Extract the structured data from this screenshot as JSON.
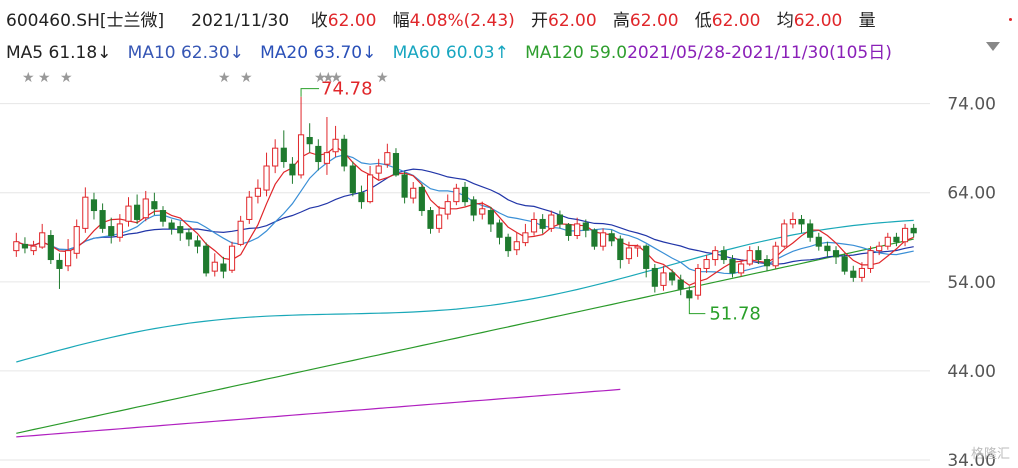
{
  "header": {
    "code": "600460.SH[士兰微]",
    "date": "2021/11/30",
    "close_label": "收",
    "close": "62.00",
    "change_label": "幅",
    "change": "4.08%(2.43)",
    "open_label": "开",
    "open": "62.00",
    "high_label": "高",
    "high": "62.00",
    "low_label": "低",
    "low": "62.00",
    "avg_label": "均",
    "avg": "62.00",
    "vol_label": "量"
  },
  "ma_bar": {
    "ma5": "MA5  61.18↓",
    "ma10": "MA10  62.30↓",
    "ma20": "MA20  63.70↓",
    "ma60": "MA60  60.03↑",
    "ma120": "MA120  59.0",
    "overlap": "2021/05/28-2021/11/30(105日)"
  },
  "colors": {
    "up": "#e0262a",
    "down": "#1f7a2e",
    "ma5": "#e0262a",
    "ma10": "#2236a8",
    "ma20": "#3a8fd6",
    "ma60": "#1aa8b8",
    "ma120": "#2a9a2a",
    "ma250": "#b020c0"
  },
  "watermark": "格隆汇",
  "chart_data": {
    "type": "candlestick",
    "ylim": [
      34,
      78
    ],
    "yticks": [
      "74.00",
      "64.00",
      "54.00",
      "44.00",
      "34.00"
    ],
    "high_mark": "74.78",
    "low_mark": "51.78",
    "candles": [
      [
        57.5,
        58.5,
        56.8,
        59.5
      ],
      [
        58.2,
        57.8,
        57.2,
        59.0
      ],
      [
        57.5,
        58.0,
        57.0,
        58.6
      ],
      [
        57.9,
        59.5,
        57.7,
        60.5
      ],
      [
        59.2,
        56.5,
        56.0,
        59.8
      ],
      [
        56.4,
        55.5,
        53.2,
        57.2
      ],
      [
        55.8,
        57.5,
        55.2,
        58.8
      ],
      [
        57.2,
        60.2,
        56.6,
        61.0
      ],
      [
        60.0,
        63.5,
        59.5,
        64.6
      ],
      [
        63.2,
        62.0,
        61.0,
        64.0
      ],
      [
        62.0,
        60.0,
        59.5,
        62.8
      ],
      [
        60.2,
        59.2,
        58.3,
        61.2
      ],
      [
        59.0,
        60.5,
        58.5,
        61.6
      ],
      [
        60.8,
        62.5,
        60.2,
        63.5
      ],
      [
        62.6,
        61.0,
        60.5,
        63.8
      ],
      [
        61.2,
        63.3,
        60.8,
        64.2
      ],
      [
        63.0,
        62.2,
        61.5,
        64.0
      ],
      [
        62.0,
        60.8,
        60.2,
        62.5
      ],
      [
        60.6,
        60.0,
        59.3,
        61.0
      ],
      [
        60.2,
        59.5,
        58.6,
        60.8
      ],
      [
        59.5,
        58.8,
        58.0,
        60.0
      ],
      [
        58.6,
        58.0,
        57.2,
        59.2
      ],
      [
        58.0,
        55.0,
        54.6,
        58.4
      ],
      [
        55.2,
        56.2,
        54.6,
        57.2
      ],
      [
        56.0,
        55.2,
        54.4,
        56.8
      ],
      [
        55.3,
        58.0,
        55.0,
        58.5
      ],
      [
        58.2,
        60.8,
        58.0,
        61.4
      ],
      [
        61.0,
        63.5,
        60.5,
        64.2
      ],
      [
        63.6,
        64.5,
        62.8,
        65.5
      ],
      [
        64.3,
        67.0,
        63.6,
        68.5
      ],
      [
        67.0,
        69.0,
        66.2,
        70.0
      ],
      [
        69.0,
        67.5,
        66.8,
        71.0
      ],
      [
        67.2,
        66.0,
        65.0,
        68.0
      ],
      [
        66.0,
        70.5,
        65.6,
        74.78
      ],
      [
        70.2,
        69.5,
        68.5,
        71.8
      ],
      [
        69.2,
        67.5,
        66.5,
        70.0
      ],
      [
        67.3,
        68.5,
        66.0,
        72.5
      ],
      [
        68.6,
        70.0,
        68.0,
        71.5
      ],
      [
        70.0,
        67.0,
        66.4,
        70.5
      ],
      [
        67.0,
        64.0,
        63.6,
        67.5
      ],
      [
        64.0,
        63.0,
        62.2,
        64.8
      ],
      [
        63.0,
        66.0,
        62.8,
        67.0
      ],
      [
        66.2,
        67.0,
        65.5,
        67.8
      ],
      [
        67.2,
        68.5,
        66.8,
        69.5
      ],
      [
        68.4,
        66.0,
        65.8,
        69.0
      ],
      [
        66.0,
        63.5,
        62.8,
        66.4
      ],
      [
        63.4,
        64.5,
        62.8,
        65.2
      ],
      [
        64.6,
        62.0,
        61.4,
        65.0
      ],
      [
        62.0,
        60.0,
        59.4,
        62.4
      ],
      [
        60.0,
        61.5,
        59.5,
        62.5
      ],
      [
        61.6,
        63.0,
        61.0,
        63.8
      ],
      [
        63.0,
        64.5,
        62.6,
        65.0
      ],
      [
        64.6,
        63.0,
        62.5,
        65.2
      ],
      [
        63.2,
        61.5,
        60.8,
        63.6
      ],
      [
        61.6,
        62.2,
        61.0,
        63.0
      ],
      [
        62.0,
        60.5,
        59.6,
        62.4
      ],
      [
        60.6,
        59.0,
        58.2,
        61.0
      ],
      [
        59.0,
        57.5,
        56.8,
        59.4
      ],
      [
        57.6,
        58.5,
        57.0,
        59.5
      ],
      [
        58.4,
        59.5,
        58.0,
        60.5
      ],
      [
        59.6,
        61.0,
        59.2,
        61.8
      ],
      [
        61.0,
        60.0,
        59.4,
        61.6
      ],
      [
        60.0,
        61.5,
        59.6,
        62.0
      ],
      [
        61.5,
        60.5,
        60.0,
        62.0
      ],
      [
        60.4,
        59.2,
        58.6,
        60.6
      ],
      [
        59.2,
        60.5,
        58.8,
        61.2
      ],
      [
        60.6,
        59.8,
        59.0,
        61.0
      ],
      [
        59.8,
        58.0,
        57.6,
        60.0
      ],
      [
        58.0,
        59.5,
        57.5,
        60.0
      ],
      [
        59.4,
        58.6,
        58.0,
        59.8
      ],
      [
        58.8,
        56.5,
        55.5,
        59.2
      ],
      [
        56.6,
        57.8,
        56.0,
        58.5
      ],
      [
        57.8,
        58.0,
        56.8,
        58.2
      ],
      [
        58.0,
        55.5,
        54.5,
        58.2
      ],
      [
        55.5,
        53.5,
        52.8,
        56.0
      ],
      [
        53.6,
        55.0,
        53.0,
        55.8
      ],
      [
        55.0,
        54.2,
        53.6,
        55.4
      ],
      [
        54.2,
        53.2,
        52.5,
        54.8
      ],
      [
        53.0,
        52.2,
        51.78,
        53.5
      ],
      [
        52.5,
        55.5,
        52.0,
        56.0
      ],
      [
        55.5,
        56.5,
        55.0,
        57.0
      ],
      [
        56.5,
        57.5,
        55.8,
        58.0
      ],
      [
        57.5,
        56.5,
        56.0,
        58.0
      ],
      [
        56.5,
        55.0,
        54.5,
        57.0
      ],
      [
        55.0,
        56.0,
        54.6,
        56.5
      ],
      [
        56.0,
        57.5,
        55.8,
        58.0
      ],
      [
        57.5,
        56.5,
        56.0,
        58.0
      ],
      [
        56.5,
        55.8,
        55.2,
        57.0
      ],
      [
        55.8,
        58.0,
        55.5,
        58.5
      ],
      [
        58.0,
        60.5,
        57.8,
        61.0
      ],
      [
        60.5,
        61.0,
        60.0,
        61.8
      ],
      [
        61.0,
        60.5,
        59.5,
        61.5
      ],
      [
        60.5,
        59.0,
        58.5,
        61.0
      ],
      [
        59.0,
        58.0,
        57.5,
        59.5
      ],
      [
        58.0,
        57.5,
        56.8,
        58.5
      ],
      [
        57.5,
        56.8,
        56.0,
        58.0
      ],
      [
        56.8,
        55.2,
        54.8,
        57.2
      ],
      [
        55.2,
        54.5,
        54.0,
        55.8
      ],
      [
        54.5,
        55.5,
        54.0,
        56.2
      ],
      [
        55.5,
        57.5,
        55.0,
        58.0
      ],
      [
        57.5,
        58.0,
        57.0,
        58.5
      ],
      [
        58.0,
        59.0,
        57.6,
        59.5
      ],
      [
        59.0,
        58.5,
        58.0,
        59.5
      ],
      [
        58.5,
        60.0,
        58.0,
        60.5
      ],
      [
        60.0,
        59.5,
        59.0,
        60.5
      ]
    ]
  }
}
